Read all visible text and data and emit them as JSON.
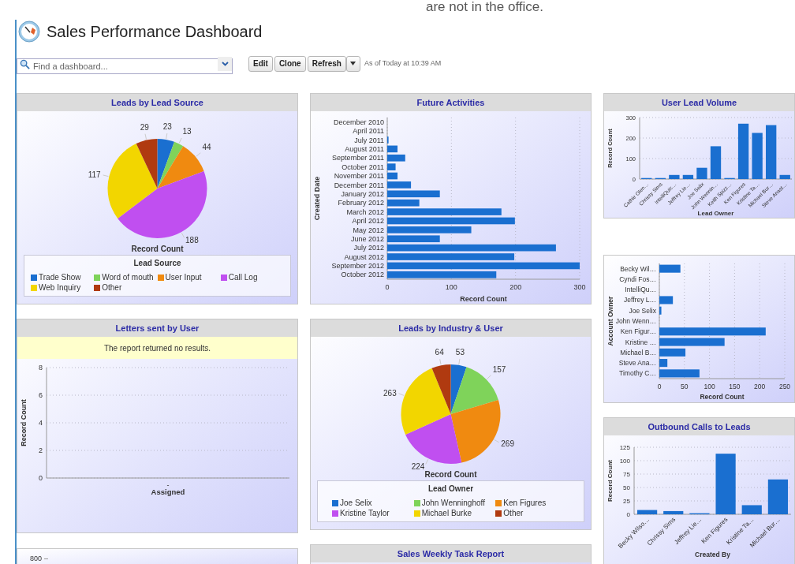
{
  "top_fragment": "are not in the office.",
  "title": "Sales Performance Dashboard",
  "search": {
    "placeholder": "Find a dashboard..."
  },
  "buttons": [
    "Edit",
    "Clone",
    "Refresh"
  ],
  "timestamp": "As of Today at 10:39 AM",
  "columns": [
    {
      "panels": [
        {
          "kind": "chart",
          "title": "Leads by Lead Source",
          "chart_data": {
            "type": "pie",
            "xlabel": "Record Count",
            "categories": [
              "Trade Show",
              "Word of mouth",
              "User Input",
              "Call Log",
              "Web Inquiry",
              "Other"
            ],
            "values": [
              23,
              13,
              44,
              188,
              117,
              29
            ],
            "data_labels": true
          },
          "legend": {
            "title": "Lead Source",
            "items": [
              {
                "color": "#1a6fd0"
              },
              {
                "color": "#7fd35a"
              },
              {
                "color": "#f08a10"
              },
              {
                "color": "#c04ff0"
              },
              {
                "color": "#f2d600"
              },
              {
                "color": "#b03a10"
              }
            ]
          }
        },
        {
          "kind": "chart",
          "title": "Letters sent by User",
          "notice": "The report returned no results.",
          "chart_data": {
            "type": "bar",
            "orientation": "vertical",
            "xlabel": "Assigned",
            "ylabel": "Record Count",
            "categories": [
              "-"
            ],
            "values": [
              null
            ],
            "yticks": [
              0,
              2,
              4,
              6,
              8
            ],
            "ylim": [
              0,
              8
            ],
            "grid": true
          }
        },
        {
          "kind": "stub",
          "tick_label": "800"
        }
      ]
    },
    {
      "panels": [
        {
          "kind": "chart",
          "title": "Future Activities",
          "chart_data": {
            "type": "bar",
            "orientation": "horizontal",
            "xlabel": "Record Count",
            "ylabel": "Created Date",
            "categories": [
              "December 2010",
              "April 2011",
              "July 2011",
              "August 2011",
              "September 2011",
              "October 2011",
              "November 2011",
              "December 2011",
              "January 2012",
              "February 2012",
              "March 2012",
              "April 2012",
              "May 2012",
              "June 2012",
              "July 2012",
              "August 2012",
              "September 2012",
              "October 2012"
            ],
            "values": [
              0,
              0,
              2,
              16,
              28,
              13,
              16,
              37,
              82,
              50,
              178,
              199,
              131,
              82,
              263,
              198,
              300,
              170
            ],
            "xticks": [
              0,
              100,
              200,
              300
            ],
            "xlim": [
              0,
              300
            ],
            "grid": true
          }
        },
        {
          "kind": "chart",
          "title": "Leads by Industry & User",
          "chart_data": {
            "type": "pie",
            "xlabel": "Record Count",
            "categories": [
              "Joe Selix",
              "John Wenninghoff",
              "Ken Figures",
              "Kristine Taylor",
              "Michael Burke",
              "Other"
            ],
            "values": [
              53,
              157,
              269,
              224,
              263,
              64
            ],
            "data_labels": true
          },
          "legend": {
            "title": "Lead Owner",
            "items": [
              {
                "color": "#1a6fd0"
              },
              {
                "color": "#7fd35a"
              },
              {
                "color": "#f08a10"
              },
              {
                "color": "#c04ff0"
              },
              {
                "color": "#f2d600"
              },
              {
                "color": "#b03a10"
              }
            ]
          }
        },
        {
          "kind": "title_only",
          "title": "Sales Weekly Task Report"
        }
      ]
    },
    {
      "panels": [
        {
          "kind": "chart",
          "title": "User Lead Volume",
          "chart_data": {
            "type": "bar",
            "orientation": "vertical",
            "xlabel": "Lead Owner",
            "ylabel": "Record Count",
            "categories": [
              "Cathie Olen…",
              "Chrissy Sims",
              "IntelliQuic…",
              "Jeffrey Lie…",
              "Joe Selix",
              "John Wennin…",
              "Keith Spizz…",
              "Ken Figures",
              "Kristine Ta…",
              "Michael Bur…",
              "Steve Anast…"
            ],
            "values": [
              5,
              5,
              20,
              20,
              55,
              160,
              5,
              270,
              225,
              263,
              20
            ],
            "yticks": [
              0,
              100,
              200,
              300
            ],
            "ylim": [
              0,
              300
            ],
            "grid": true
          }
        },
        {
          "kind": "chart",
          "chart_data": {
            "type": "bar",
            "orientation": "horizontal",
            "xlabel": "Record Count",
            "ylabel": "Account Owner",
            "categories": [
              "Becky Wil…",
              "Cyndi Fos…",
              "IntelliQu…",
              "Jeffrey L…",
              "Joe Selix",
              "John Wenn…",
              "Ken Figur…",
              "Kristine …",
              "Michael B…",
              "Steve Ana…",
              "Timothy C…"
            ],
            "values": [
              42,
              0,
              0,
              27,
              4,
              0,
              212,
              130,
              52,
              16,
              80
            ],
            "xticks": [
              0,
              50,
              100,
              150,
              200,
              250
            ],
            "xlim": [
              0,
              250
            ],
            "grid": true
          }
        },
        {
          "kind": "chart",
          "title": "Outbound Calls to Leads",
          "chart_data": {
            "type": "bar",
            "orientation": "vertical",
            "xlabel": "Created By",
            "ylabel": "Record Count",
            "categories": [
              "Becky Wilso…",
              "Chrissy Sims",
              "Jeffrey Lie…",
              "Ken Figures",
              "Kristine Ta…",
              "Michael Bur…"
            ],
            "values": [
              8,
              6,
              2,
              113,
              17,
              65
            ],
            "yticks": [
              0,
              25,
              50,
              75,
              100,
              125
            ],
            "ylim": [
              0,
              125
            ],
            "grid": true
          }
        }
      ]
    }
  ]
}
